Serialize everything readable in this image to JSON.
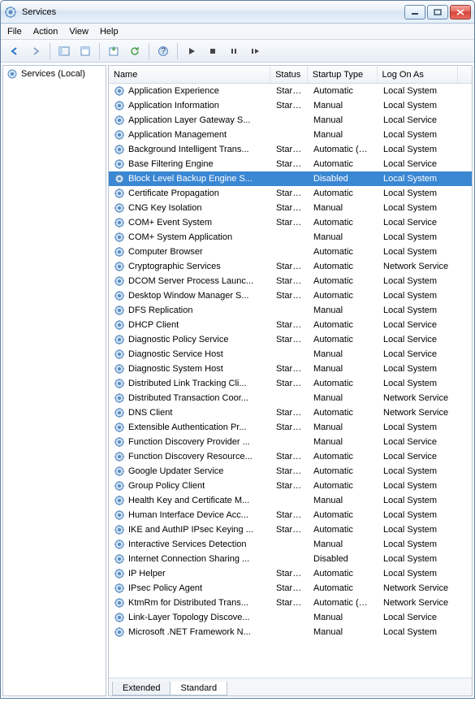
{
  "title": "Services",
  "menu": {
    "file": "File",
    "action": "Action",
    "view": "View",
    "help": "Help"
  },
  "tree": {
    "root": "Services (Local)"
  },
  "columns": {
    "name": "Name",
    "status": "Status",
    "startup": "Startup Type",
    "logon": "Log On As"
  },
  "tabs": {
    "extended": "Extended",
    "standard": "Standard"
  },
  "services": [
    {
      "name": "Application Experience",
      "status": "Started",
      "startup": "Automatic",
      "logon": "Local System"
    },
    {
      "name": "Application Information",
      "status": "Started",
      "startup": "Manual",
      "logon": "Local System"
    },
    {
      "name": "Application Layer Gateway S...",
      "status": "",
      "startup": "Manual",
      "logon": "Local Service"
    },
    {
      "name": "Application Management",
      "status": "",
      "startup": "Manual",
      "logon": "Local System"
    },
    {
      "name": "Background Intelligent Trans...",
      "status": "Started",
      "startup": "Automatic (Del...",
      "logon": "Local System"
    },
    {
      "name": "Base Filtering Engine",
      "status": "Started",
      "startup": "Automatic",
      "logon": "Local Service"
    },
    {
      "name": "Block Level Backup Engine S...",
      "status": "",
      "startup": "Disabled",
      "logon": "Local System",
      "selected": true
    },
    {
      "name": "Certificate Propagation",
      "status": "Started",
      "startup": "Automatic",
      "logon": "Local System"
    },
    {
      "name": "CNG Key Isolation",
      "status": "Started",
      "startup": "Manual",
      "logon": "Local System"
    },
    {
      "name": "COM+ Event System",
      "status": "Started",
      "startup": "Automatic",
      "logon": "Local Service"
    },
    {
      "name": "COM+ System Application",
      "status": "",
      "startup": "Manual",
      "logon": "Local System"
    },
    {
      "name": "Computer Browser",
      "status": "",
      "startup": "Automatic",
      "logon": "Local System"
    },
    {
      "name": "Cryptographic Services",
      "status": "Started",
      "startup": "Automatic",
      "logon": "Network Service"
    },
    {
      "name": "DCOM Server Process Launc...",
      "status": "Started",
      "startup": "Automatic",
      "logon": "Local System"
    },
    {
      "name": "Desktop Window Manager S...",
      "status": "Started",
      "startup": "Automatic",
      "logon": "Local System"
    },
    {
      "name": "DFS Replication",
      "status": "",
      "startup": "Manual",
      "logon": "Local System"
    },
    {
      "name": "DHCP Client",
      "status": "Started",
      "startup": "Automatic",
      "logon": "Local Service"
    },
    {
      "name": "Diagnostic Policy Service",
      "status": "Started",
      "startup": "Automatic",
      "logon": "Local Service"
    },
    {
      "name": "Diagnostic Service Host",
      "status": "",
      "startup": "Manual",
      "logon": "Local Service"
    },
    {
      "name": "Diagnostic System Host",
      "status": "Started",
      "startup": "Manual",
      "logon": "Local System"
    },
    {
      "name": "Distributed Link Tracking Cli...",
      "status": "Started",
      "startup": "Automatic",
      "logon": "Local System"
    },
    {
      "name": "Distributed Transaction Coor...",
      "status": "",
      "startup": "Manual",
      "logon": "Network Service"
    },
    {
      "name": "DNS Client",
      "status": "Started",
      "startup": "Automatic",
      "logon": "Network Service"
    },
    {
      "name": "Extensible Authentication Pr...",
      "status": "Started",
      "startup": "Manual",
      "logon": "Local System"
    },
    {
      "name": "Function Discovery Provider ...",
      "status": "",
      "startup": "Manual",
      "logon": "Local Service"
    },
    {
      "name": "Function Discovery Resource...",
      "status": "Started",
      "startup": "Automatic",
      "logon": "Local Service"
    },
    {
      "name": "Google Updater Service",
      "status": "Started",
      "startup": "Automatic",
      "logon": "Local System"
    },
    {
      "name": "Group Policy Client",
      "status": "Started",
      "startup": "Automatic",
      "logon": "Local System"
    },
    {
      "name": "Health Key and Certificate M...",
      "status": "",
      "startup": "Manual",
      "logon": "Local System"
    },
    {
      "name": "Human Interface Device Acc...",
      "status": "Started",
      "startup": "Automatic",
      "logon": "Local System"
    },
    {
      "name": "IKE and AuthIP IPsec Keying ...",
      "status": "Started",
      "startup": "Automatic",
      "logon": "Local System"
    },
    {
      "name": "Interactive Services Detection",
      "status": "",
      "startup": "Manual",
      "logon": "Local System"
    },
    {
      "name": "Internet Connection Sharing ...",
      "status": "",
      "startup": "Disabled",
      "logon": "Local System"
    },
    {
      "name": "IP Helper",
      "status": "Started",
      "startup": "Automatic",
      "logon": "Local System"
    },
    {
      "name": "IPsec Policy Agent",
      "status": "Started",
      "startup": "Automatic",
      "logon": "Network Service"
    },
    {
      "name": "KtmRm for Distributed Trans...",
      "status": "Started",
      "startup": "Automatic (Del...",
      "logon": "Network Service"
    },
    {
      "name": "Link-Layer Topology Discove...",
      "status": "",
      "startup": "Manual",
      "logon": "Local Service"
    },
    {
      "name": "Microsoft .NET Framework N...",
      "status": "",
      "startup": "Manual",
      "logon": "Local System"
    }
  ]
}
